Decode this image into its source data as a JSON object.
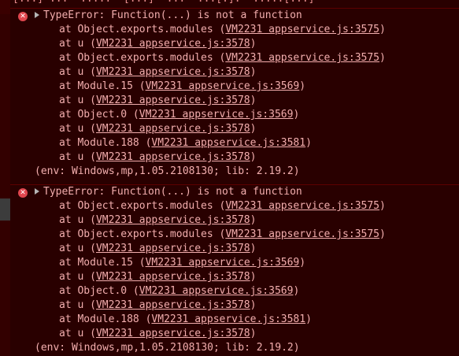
{
  "cutoff_text": "[...] ...  .....  [...]  ...  ...[.].  .....[...]",
  "entries": [
    {
      "message": "TypeError: Function(...) is not a function",
      "frames": [
        {
          "func": "Object.exports.modules",
          "source": "VM2231 appservice.js:3575"
        },
        {
          "func": "u",
          "source": "VM2231 appservice.js:3578"
        },
        {
          "func": "Object.exports.modules",
          "source": "VM2231 appservice.js:3575"
        },
        {
          "func": "u",
          "source": "VM2231 appservice.js:3578"
        },
        {
          "func": "Module.15",
          "source": "VM2231 appservice.js:3569"
        },
        {
          "func": "u",
          "source": "VM2231 appservice.js:3578"
        },
        {
          "func": "Object.0",
          "source": "VM2231 appservice.js:3569"
        },
        {
          "func": "u",
          "source": "VM2231 appservice.js:3578"
        },
        {
          "func": "Module.188",
          "source": "VM2231 appservice.js:3581"
        },
        {
          "func": "u",
          "source": "VM2231 appservice.js:3578"
        }
      ],
      "env": "(env: Windows,mp,1.05.2108130; lib: 2.19.2)"
    },
    {
      "message": "TypeError: Function(...) is not a function",
      "frames": [
        {
          "func": "Object.exports.modules",
          "source": "VM2231 appservice.js:3575"
        },
        {
          "func": "u",
          "source": "VM2231 appservice.js:3578"
        },
        {
          "func": "Object.exports.modules",
          "source": "VM2231 appservice.js:3575"
        },
        {
          "func": "u",
          "source": "VM2231 appservice.js:3578"
        },
        {
          "func": "Module.15",
          "source": "VM2231 appservice.js:3569"
        },
        {
          "func": "u",
          "source": "VM2231 appservice.js:3578"
        },
        {
          "func": "Object.0",
          "source": "VM2231 appservice.js:3569"
        },
        {
          "func": "u",
          "source": "VM2231 appservice.js:3578"
        },
        {
          "func": "Module.188",
          "source": "VM2231 appservice.js:3581"
        },
        {
          "func": "u",
          "source": "VM2231 appservice.js:3578"
        }
      ],
      "env": "(env: Windows,mp,1.05.2108130; lib: 2.19.2)"
    }
  ],
  "icons": {
    "error": "error-x-icon",
    "expand": "triangle-right-icon"
  },
  "colors": {
    "error_background": "#290000",
    "error_text": "#f2aeae",
    "error_border": "#5c0000",
    "error_icon": "#e0464e",
    "gutter": "#202020"
  }
}
